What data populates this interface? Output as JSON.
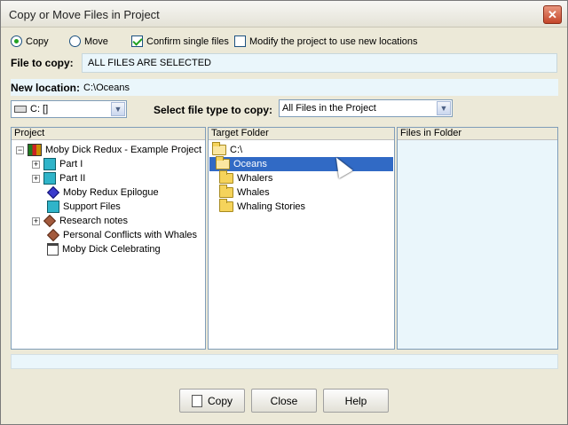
{
  "window": {
    "title": "Copy or Move Files in Project",
    "close_glyph": "✕"
  },
  "options": {
    "copy_label": "Copy",
    "move_label": "Move",
    "confirm_label": "Confirm single files",
    "modify_label": "Modify the project to use new locations",
    "copy_selected": true,
    "move_selected": false,
    "confirm_checked": true,
    "modify_checked": false
  },
  "file_to_copy": {
    "label": "File to copy:",
    "value": "ALL FILES ARE SELECTED"
  },
  "new_location": {
    "label": "New location:",
    "value": "C:\\Oceans"
  },
  "drive_combo": {
    "value": "C: []",
    "icon": "drive-icon"
  },
  "file_type": {
    "label": "Select file type to copy:",
    "value": "All Files in the Project"
  },
  "project_panel": {
    "header": "Project",
    "root": "Moby Dick Redux - Example Project",
    "items": [
      {
        "label": "Part I",
        "icon": "book-icon",
        "expandable": true
      },
      {
        "label": "Part II",
        "icon": "book-icon",
        "expandable": true
      },
      {
        "label": "Moby Redux Epilogue",
        "icon": "diamond-icon",
        "expandable": false
      },
      {
        "label": "Support Files",
        "icon": "book-icon",
        "expandable": false
      },
      {
        "label": "Research notes",
        "icon": "notes-icon",
        "expandable": true
      },
      {
        "label": "Personal Conflicts with Whales",
        "icon": "notes-icon",
        "expandable": false
      },
      {
        "label": "Moby Dick Celebrating",
        "icon": "document-icon",
        "expandable": false
      }
    ]
  },
  "target_panel": {
    "header": "Target Folder",
    "drive": "C:\\",
    "folders": [
      {
        "label": "Oceans",
        "selected": true
      },
      {
        "label": "Whalers",
        "selected": false
      },
      {
        "label": "Whales",
        "selected": false
      },
      {
        "label": "Whaling Stories",
        "selected": false
      }
    ]
  },
  "files_panel": {
    "header": "Files in Folder"
  },
  "buttons": {
    "copy": "Copy",
    "close": "Close",
    "help": "Help"
  }
}
